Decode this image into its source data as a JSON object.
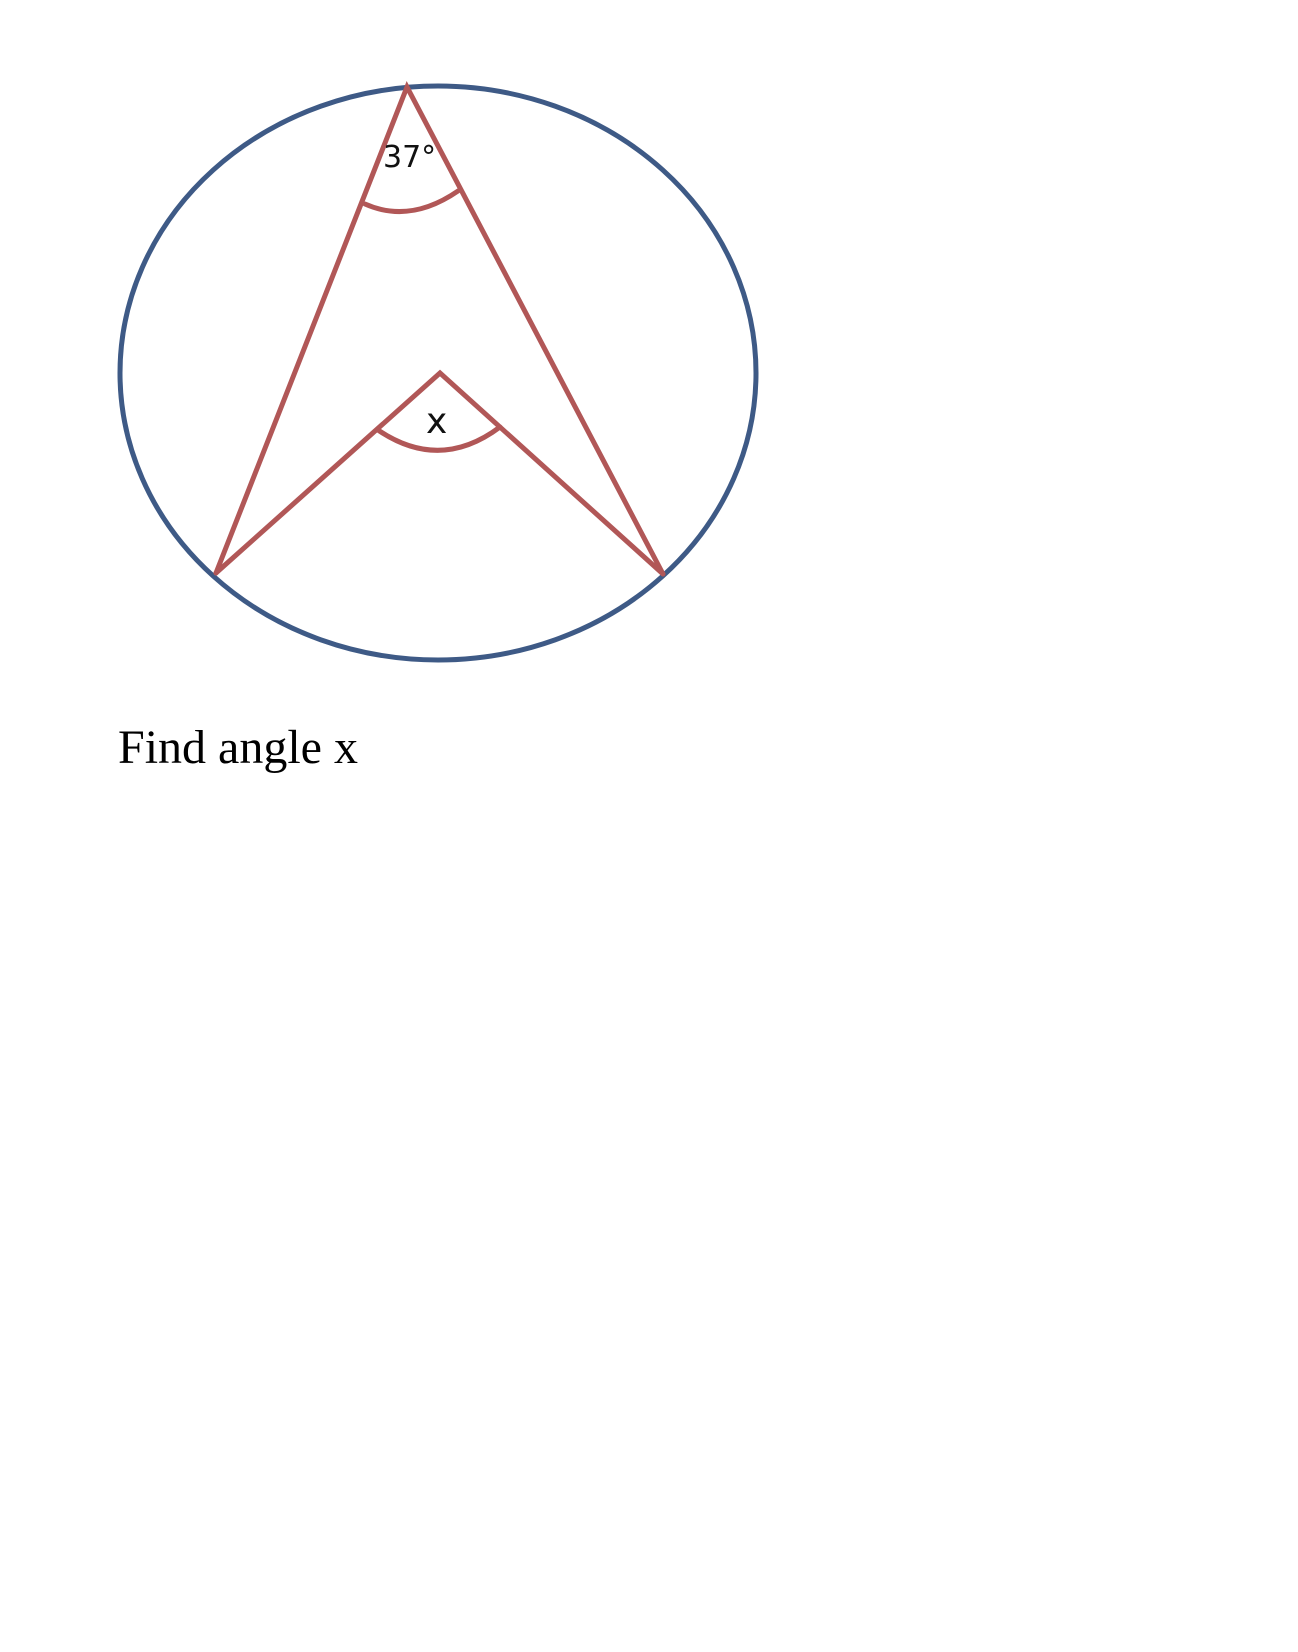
{
  "diagram": {
    "inscribed_angle_label": "37°",
    "central_angle_label": "x"
  },
  "question": {
    "text": "Find angle x"
  },
  "colors": {
    "circle": "#3e5a86",
    "lines": "#b15757"
  }
}
